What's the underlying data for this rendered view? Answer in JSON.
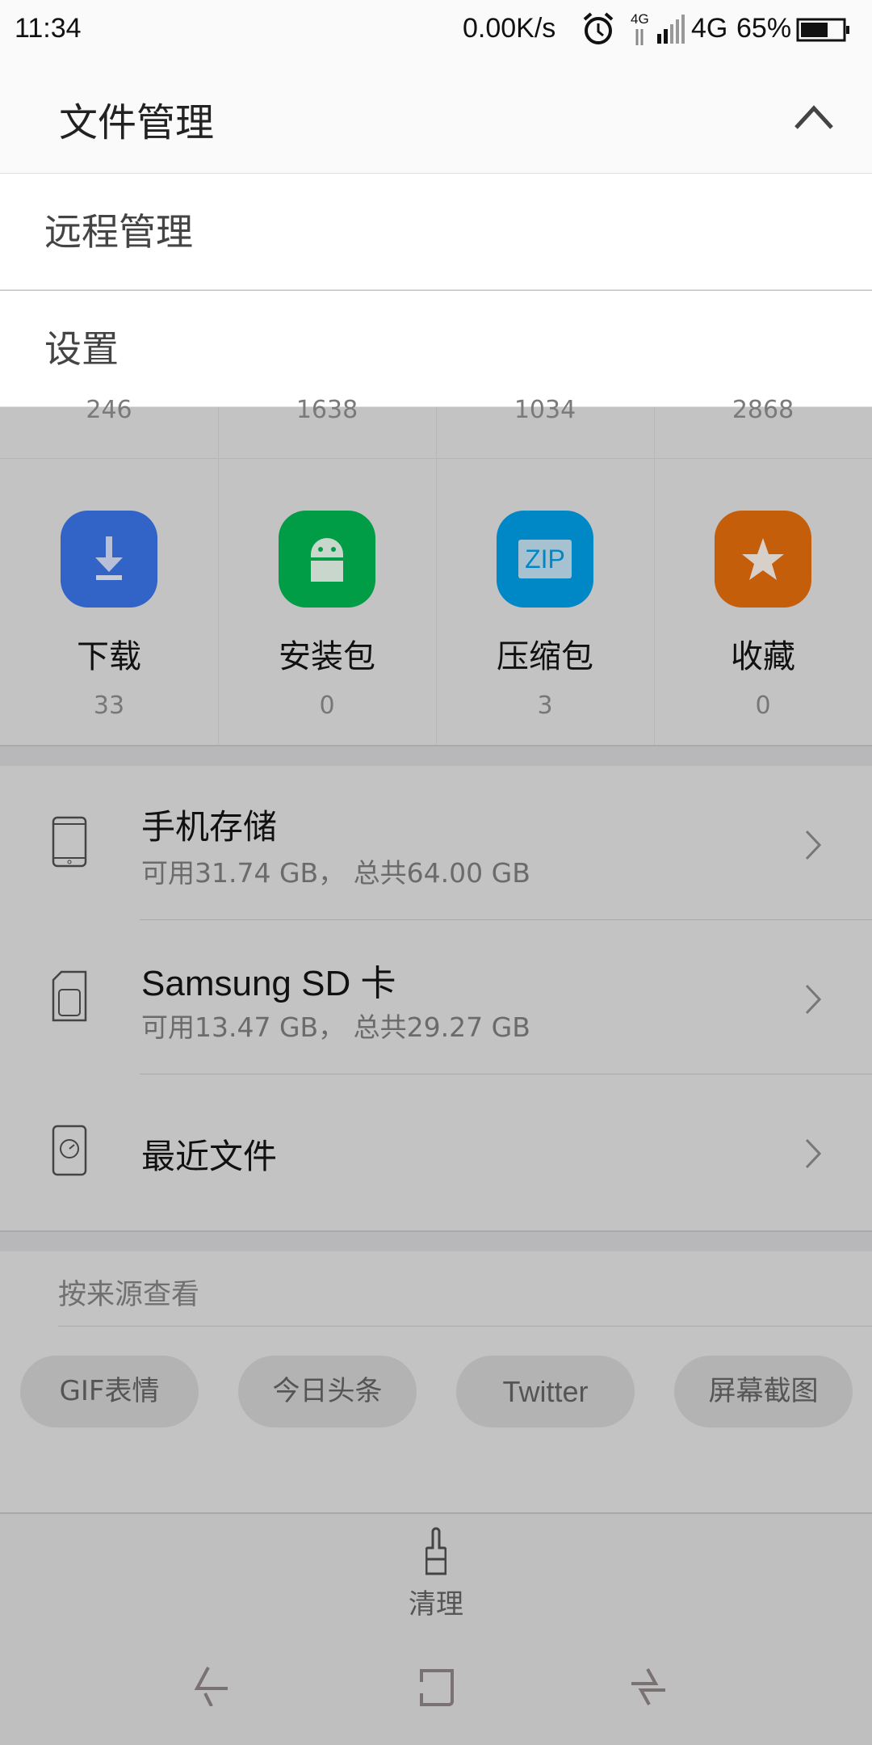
{
  "status_bar": {
    "time": "11:34",
    "net_speed": "0.00K/s",
    "network_small": "4G",
    "network": "4G",
    "battery": "65%",
    "battery_level": 0.65,
    "icons": [
      "alarm-icon",
      "data-arrows-icon",
      "signal-icon",
      "battery-icon"
    ]
  },
  "header": {
    "title": "文件管理",
    "collapse_icon": "chevron-up-icon"
  },
  "menu": {
    "items": [
      {
        "label": "远程管理"
      },
      {
        "label": "设置"
      }
    ]
  },
  "top_counts": [
    "246",
    "1638",
    "1034",
    "2868"
  ],
  "categories": [
    {
      "label": "下载",
      "count": "33",
      "icon": "download-icon",
      "color": "#3264c8"
    },
    {
      "label": "安装包",
      "count": "0",
      "icon": "android-icon",
      "color": "#009c46"
    },
    {
      "label": "压缩包",
      "count": "3",
      "icon": "zip-icon",
      "color": "#0088c6",
      "icon_text": "ZIP"
    },
    {
      "label": "收藏",
      "count": "0",
      "icon": "star-icon",
      "color": "#c55e0a"
    }
  ],
  "storage": [
    {
      "title": "手机存储",
      "subtitle": "可用31.74 GB， 总共64.00 GB",
      "icon": "phone-icon"
    },
    {
      "title": "Samsung SD 卡",
      "subtitle": "可用13.47 GB， 总共29.27 GB",
      "icon": "sd-card-icon"
    },
    {
      "title": "最近文件",
      "icon": "recent-clock-icon"
    }
  ],
  "sources": {
    "title": "按来源查看",
    "chips": [
      "GIF表情",
      "今日头条",
      "Twitter",
      "屏幕截图"
    ]
  },
  "bottom": {
    "clean_label": "清理"
  }
}
